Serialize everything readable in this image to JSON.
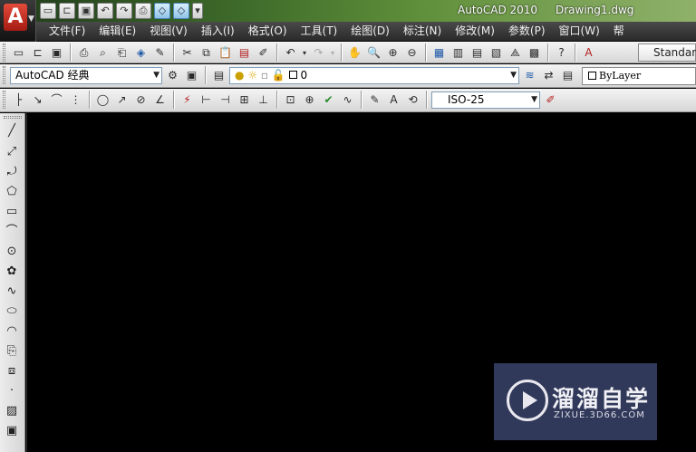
{
  "titlebar": {
    "app_name": "AutoCAD 2010",
    "document": "Drawing1.dwg",
    "logo_letter": "A",
    "quick_access": [
      "new-icon",
      "open-icon",
      "save-icon",
      "undo-icon",
      "redo-icon",
      "plot-icon",
      "workspace-cube-icon",
      "workspace-cube2-icon",
      "qat-dropdown-icon"
    ]
  },
  "menu": {
    "items": [
      "文件(F)",
      "编辑(E)",
      "视图(V)",
      "插入(I)",
      "格式(O)",
      "工具(T)",
      "绘图(D)",
      "标注(N)",
      "修改(M)",
      "参数(P)",
      "窗口(W)",
      "帮"
    ]
  },
  "standard_toolbar": {
    "text_style_value": "Standard"
  },
  "workspace": {
    "selected": "AutoCAD 经典"
  },
  "layers": {
    "current_layer": "0",
    "color_value": "ByLayer"
  },
  "dimension": {
    "style_value": "ISO-25"
  },
  "watermark": {
    "brand": "溜溜自学",
    "url": "ZIXUE.3D66.COM"
  },
  "colors": {
    "canvas": "#000000",
    "menubar": "#2e2e2e",
    "logo_red": "#c62b1f"
  }
}
